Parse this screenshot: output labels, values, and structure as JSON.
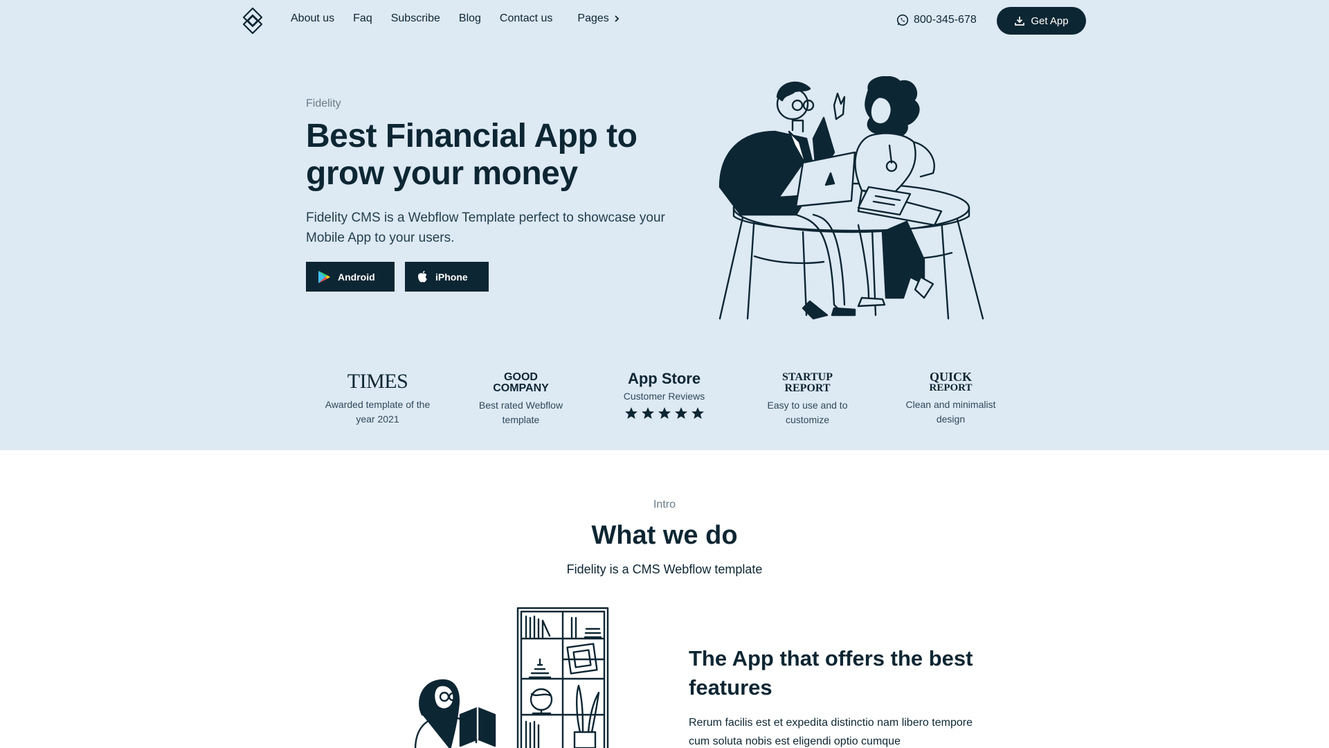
{
  "nav": {
    "links": [
      "About us",
      "Faq",
      "Subscribe",
      "Blog",
      "Contact us"
    ],
    "pages_label": "Pages",
    "phone": "800-345-678",
    "get_app": "Get App"
  },
  "hero": {
    "eyebrow": "Fidelity",
    "title": "Best Financial App to grow your money",
    "description": "Fidelity CMS is a Webflow Template perfect to showcase your Mobile App to your users.",
    "android_label": "Android",
    "iphone_label": "iPhone"
  },
  "badges": [
    {
      "title": "TIMES",
      "subtitle": "Awarded template of the year 2021"
    },
    {
      "title_line1": "GOOD",
      "title_line2": "COMPANY",
      "subtitle": "Best rated Webflow template"
    },
    {
      "title": "App Store",
      "subtitle": "Customer Reviews",
      "stars": 5
    },
    {
      "title_line1": "Startup",
      "title_line2": "Report",
      "subtitle": "Easy to use and to customize"
    },
    {
      "title_line1": "Quick",
      "title_line2": "Report",
      "subtitle": "Clean and minimalist design"
    }
  ],
  "intro": {
    "eyebrow": "Intro",
    "title": "What we do",
    "subtitle": "Fidelity is a CMS Webflow template"
  },
  "feature": {
    "title": "The App that offers the best features",
    "description": "Rerum facilis est et expedita distinctio nam libero tempore cum soluta nobis est eligendi optio cumque"
  },
  "colors": {
    "hero_bg": "#dde9f3",
    "primary": "#0d2633"
  }
}
